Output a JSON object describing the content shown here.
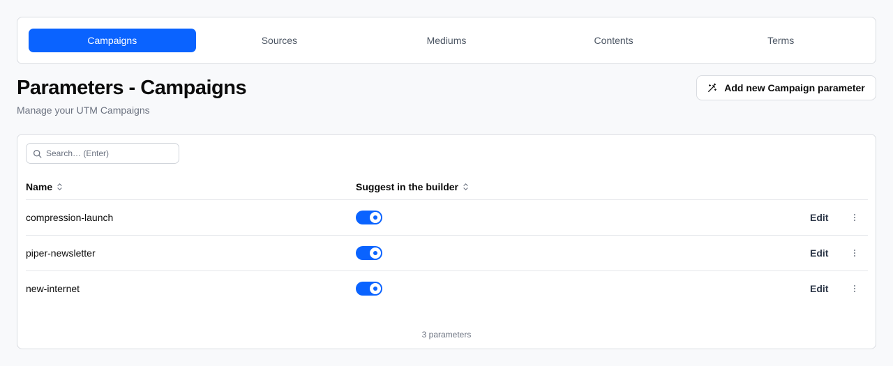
{
  "tabs": [
    {
      "label": "Campaigns",
      "active": true
    },
    {
      "label": "Sources",
      "active": false
    },
    {
      "label": "Mediums",
      "active": false
    },
    {
      "label": "Contents",
      "active": false
    },
    {
      "label": "Terms",
      "active": false
    }
  ],
  "header": {
    "title": "Parameters - Campaigns",
    "subtitle": "Manage your UTM Campaigns",
    "add_button_label": "Add new Campaign parameter",
    "add_button_icon": "magic-wand-icon"
  },
  "search": {
    "placeholder": "Search… (Enter)",
    "value": "",
    "icon": "search-icon"
  },
  "table": {
    "columns": [
      {
        "label": "Name",
        "sortable": true
      },
      {
        "label": "Suggest in the builder",
        "sortable": true
      }
    ],
    "rows": [
      {
        "name": "compression-launch",
        "suggest": true,
        "edit_label": "Edit"
      },
      {
        "name": "piper-newsletter",
        "suggest": true,
        "edit_label": "Edit"
      },
      {
        "name": "new-internet",
        "suggest": true,
        "edit_label": "Edit"
      }
    ],
    "count_label": "3 parameters"
  },
  "colors": {
    "accent": "#0a63ff",
    "background": "#f8f9fb",
    "border": "#d9dce1"
  }
}
